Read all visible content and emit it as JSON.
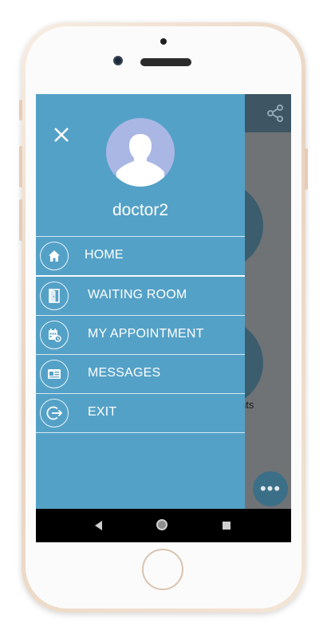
{
  "drawer": {
    "username": "doctor2",
    "items": [
      {
        "label": "HOME",
        "icon": "home-icon"
      },
      {
        "label": "WAITING ROOM",
        "icon": "door-icon"
      },
      {
        "label": "MY APPOINTMENT",
        "icon": "calendar-clock-icon"
      },
      {
        "label": "MESSAGES",
        "icon": "message-card-icon"
      },
      {
        "label": "EXIT",
        "icon": "exit-icon"
      }
    ]
  },
  "background": {
    "partial_text": "nts"
  },
  "colors": {
    "drawer_bg": "#54a1c7",
    "app_topbar": "#3e5563",
    "overlay": "#6f7376",
    "avatar_bg": "#aab7e4",
    "fab": "#3b6f87"
  }
}
